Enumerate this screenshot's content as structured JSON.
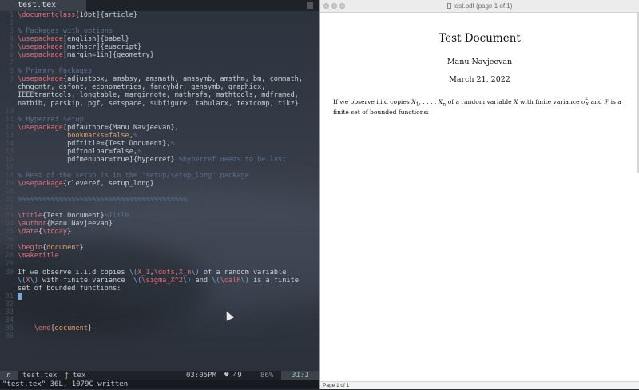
{
  "editor": {
    "tab_label": "test.tex",
    "lines": [
      {
        "n": "1",
        "segs": [
          [
            "kw",
            "\\documentclass"
          ],
          [
            "pl",
            "[10pt]{article}"
          ]
        ]
      },
      {
        "n": "2",
        "segs": []
      },
      {
        "n": "3",
        "segs": [
          [
            "cm",
            "% Packages with options"
          ]
        ]
      },
      {
        "n": "4",
        "segs": [
          [
            "kw",
            "\\usepackage"
          ],
          [
            "pl",
            "[english]{babel}"
          ]
        ]
      },
      {
        "n": "5",
        "segs": [
          [
            "kw",
            "\\usepackage"
          ],
          [
            "pl",
            "[mathscr]{euscript}"
          ]
        ]
      },
      {
        "n": "6",
        "segs": [
          [
            "kw",
            "\\usepackage"
          ],
          [
            "pl",
            "[margin=1in]{geometry}"
          ]
        ]
      },
      {
        "n": "7",
        "segs": []
      },
      {
        "n": "8",
        "segs": [
          [
            "cm",
            "% Primary Packages"
          ]
        ]
      },
      {
        "n": "9",
        "segs": [
          [
            "kw",
            "\\usepackage"
          ],
          [
            "pl",
            "{adjustbox, amsbsy, amsmath, amssymb, amsthm, bm, commath,"
          ]
        ]
      },
      {
        "n": "",
        "segs": [
          [
            "pl",
            "chngcntr, dsfont, econometrics, fancyhdr, gensymb, graphicx,"
          ]
        ]
      },
      {
        "n": "",
        "segs": [
          [
            "pl",
            "IEEEtrantools, longtable, marginnote, mathrsfs, mathtools, mdframed,"
          ]
        ]
      },
      {
        "n": "",
        "segs": [
          [
            "pl",
            "natbib, parskip, pgf, setspace, subfigure, tabularx, textcomp, tikz}"
          ]
        ]
      },
      {
        "n": "10",
        "segs": []
      },
      {
        "n": "11",
        "segs": [
          [
            "cm",
            "% Hyperref Setup"
          ]
        ]
      },
      {
        "n": "12",
        "segs": [
          [
            "kw",
            "\\usepackage"
          ],
          [
            "pl",
            "[pdfauthor={Manu Navjeevan},"
          ]
        ]
      },
      {
        "n": "13",
        "segs": [
          [
            "pl",
            "            "
          ],
          [
            "ar",
            "bookmarks=false,"
          ],
          [
            "cm",
            "%"
          ]
        ]
      },
      {
        "n": "14",
        "segs": [
          [
            "pl",
            "            pdftitle={Test Document},"
          ],
          [
            "cm",
            "%"
          ]
        ]
      },
      {
        "n": "15",
        "segs": [
          [
            "pl",
            "            pdftoolbar=false,"
          ],
          [
            "cm",
            "%"
          ]
        ]
      },
      {
        "n": "16",
        "segs": [
          [
            "pl",
            "            pdfmenubar=true]{hyperref} "
          ],
          [
            "cm",
            "%hyperref needs to be last"
          ]
        ]
      },
      {
        "n": "17",
        "segs": []
      },
      {
        "n": "18",
        "segs": [
          [
            "cm",
            "% Rest of the setup is in the \"setup/setup_long\" package"
          ]
        ]
      },
      {
        "n": "19",
        "segs": [
          [
            "kw",
            "\\usepackage"
          ],
          [
            "pl",
            "{cleveref, setup_long}"
          ]
        ]
      },
      {
        "n": "20",
        "segs": []
      },
      {
        "n": "21",
        "segs": [
          [
            "cm",
            "%%%%%%%%%%%%%%%%%%%%%%%%%%%%%%%%%%%%%%%%%"
          ]
        ]
      },
      {
        "n": "22",
        "segs": []
      },
      {
        "n": "23",
        "segs": [
          [
            "kw",
            "\\title"
          ],
          [
            "pl",
            "{Test Document}"
          ],
          [
            "cm",
            "%Title"
          ]
        ]
      },
      {
        "n": "24",
        "segs": [
          [
            "kw",
            "\\author"
          ],
          [
            "pl",
            "{Manu Navjeevan}"
          ]
        ]
      },
      {
        "n": "25",
        "segs": [
          [
            "kw",
            "\\date"
          ],
          [
            "pl",
            "{"
          ],
          [
            "kw",
            "\\today"
          ],
          [
            "pl",
            "}"
          ]
        ]
      },
      {
        "n": "26",
        "segs": []
      },
      {
        "n": "27",
        "segs": [
          [
            "kw",
            "\\begin"
          ],
          [
            "pl",
            "{"
          ],
          [
            "ar",
            "document"
          ],
          [
            "pl",
            "}"
          ]
        ]
      },
      {
        "n": "28",
        "segs": [
          [
            "kw",
            "\\maketitle"
          ]
        ]
      },
      {
        "n": "29",
        "segs": []
      },
      {
        "n": "30",
        "segs": [
          [
            "pl",
            "If we observe i.i.d copies "
          ],
          [
            "sp",
            "\\("
          ],
          [
            "kw",
            "X_1"
          ],
          [
            "pl",
            ","
          ],
          [
            "kw",
            "\\dots"
          ],
          [
            "pl",
            ","
          ],
          [
            "kw",
            "X_n"
          ],
          [
            "sp",
            "\\)"
          ],
          [
            "pl",
            " of a random variable"
          ]
        ]
      },
      {
        "n": "",
        "segs": [
          [
            "sp",
            "\\("
          ],
          [
            "kw",
            "X"
          ],
          [
            "sp",
            "\\)"
          ],
          [
            "pl",
            " with finite variance  "
          ],
          [
            "sp",
            "\\("
          ],
          [
            "kw",
            "\\sigma_X^2"
          ],
          [
            "sp",
            "\\)"
          ],
          [
            "pl",
            " and "
          ],
          [
            "sp",
            "\\("
          ],
          [
            "kw",
            "\\calF"
          ],
          [
            "sp",
            "\\)"
          ],
          [
            "pl",
            " is a finite"
          ]
        ]
      },
      {
        "n": "",
        "segs": [
          [
            "pl",
            "set of bounded functions:"
          ]
        ]
      },
      {
        "n": "31",
        "segs": [
          [
            "cursor",
            ""
          ]
        ]
      },
      {
        "n": "32",
        "segs": []
      },
      {
        "n": "33",
        "segs": []
      },
      {
        "n": "34",
        "segs": []
      },
      {
        "n": "35",
        "segs": [
          [
            "pl",
            "    "
          ],
          [
            "kw",
            "\\end"
          ],
          [
            "pl",
            "{"
          ],
          [
            "ar",
            "document"
          ],
          [
            "pl",
            "}"
          ]
        ]
      },
      {
        "n": "36",
        "segs": []
      }
    ],
    "status": {
      "mode": "n",
      "file": "test.tex",
      "filetype_icon": "ƒ",
      "filetype": "tex",
      "time": "03:05PM",
      "heart": "♥ 49",
      "percent": "86%",
      "position": "31:1"
    },
    "message": "\"test.tex\" 36L, 1079C written"
  },
  "viewer": {
    "window_title": "test.pdf (page 1 of 1)",
    "doc_title": "Test Document",
    "doc_author": "Manu Navjeevan",
    "doc_date": "March 21, 2022",
    "body": {
      "t1": "If we observe i.i.d copies ",
      "m1": "X",
      "m1s": "1",
      "t2": ", . . . , ",
      "m2": "X",
      "m2s": "n",
      "t3": " of a random variable ",
      "m3": "X",
      "t4": " with finite variance ",
      "m4": "σ",
      "m4sup": "2",
      "m4sub": "X",
      "t5": " and ",
      "m5": "ℱ",
      "t6": " is a finite set of bounded functions:"
    },
    "footer": "Page 1 of 1"
  }
}
